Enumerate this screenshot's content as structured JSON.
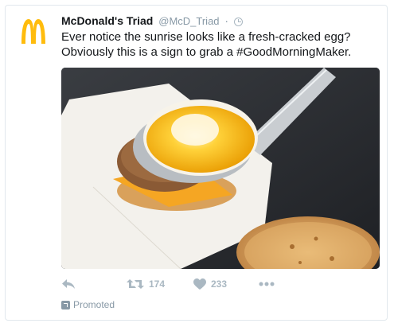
{
  "tweet": {
    "display_name": "McDonald's Triad",
    "handle": "@McD_Triad",
    "separator": "·",
    "text_line1": "Ever notice the sunrise looks like a fresh-cracked egg?",
    "text_line2": "Obviously this is a sign to grab a #GoodMorningMaker.",
    "avatar_icon": "mcdonalds-golden-arches-logo",
    "media_icon": "egg-sandwich-photo"
  },
  "actions": {
    "reply_icon": "reply-icon",
    "retweet_icon": "retweet-icon",
    "retweet_count": "174",
    "like_icon": "heart-icon",
    "like_count": "233",
    "more_icon": "more-icon"
  },
  "promoted": {
    "label": "Promoted",
    "icon": "promoted-icon"
  },
  "colors": {
    "brand_yellow": "#ffbc0d",
    "muted": "#aab8c2",
    "text": "#14171a",
    "border": "#e1e8ed"
  }
}
